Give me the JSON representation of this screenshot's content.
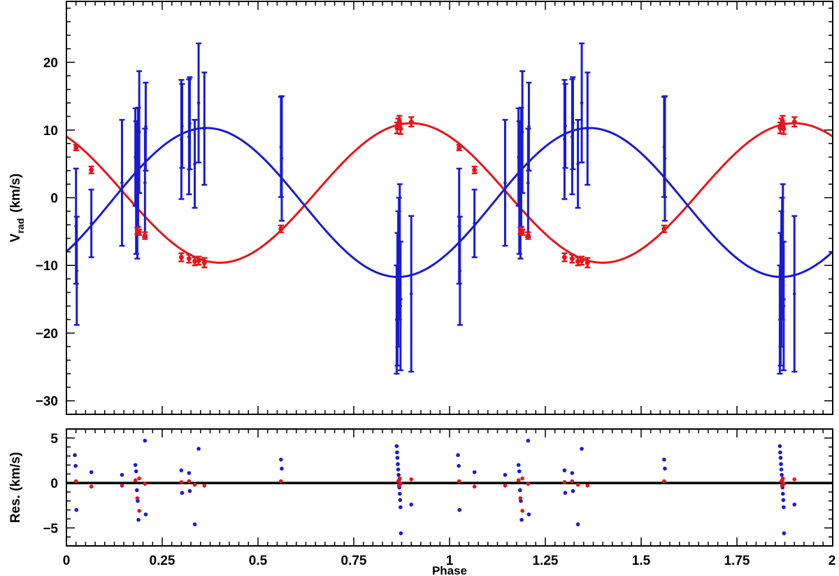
{
  "chart_data": [
    {
      "type": "scatter",
      "panel": "top",
      "xlabel": "",
      "ylabel_main": "V",
      "ylabel_sub": "rad",
      "ylabel_unit": "(km/s)",
      "xlim": [
        0,
        2
      ],
      "ylim": [
        -32,
        29
      ],
      "y_ticks": [
        20,
        10,
        0,
        -10,
        -20,
        -30
      ],
      "y_tick_labels": [
        "20",
        "10",
        "0",
        "−10",
        "−20",
        "−30"
      ],
      "colors": {
        "primary": "#e8141b",
        "secondary": "#1a1ad6",
        "axis": "#000000"
      },
      "models": [
        {
          "color": "#e8141b",
          "gamma": 0.7,
          "K": 10.3,
          "phase_max": 0.9
        },
        {
          "color": "#1a1ad6",
          "gamma": -0.7,
          "K": 11.0,
          "phase_max": 0.365
        }
      ],
      "series": [
        {
          "color": "#e8141b",
          "points": [
            {
              "x": 0.025,
              "y": 7.4,
              "err": 0.4
            },
            {
              "x": 0.065,
              "y": 4.1,
              "err": 0.5
            },
            {
              "x": 0.185,
              "y": -4.9,
              "err": 0.5
            },
            {
              "x": 0.19,
              "y": -5.1,
              "err": 0.4
            },
            {
              "x": 0.205,
              "y": -5.6,
              "err": 0.5
            },
            {
              "x": 0.3,
              "y": -8.8,
              "err": 0.6
            },
            {
              "x": 0.32,
              "y": -9.0,
              "err": 0.6
            },
            {
              "x": 0.335,
              "y": -9.4,
              "err": 0.6
            },
            {
              "x": 0.345,
              "y": -9.3,
              "err": 0.6
            },
            {
              "x": 0.36,
              "y": -9.6,
              "err": 0.7
            },
            {
              "x": 0.56,
              "y": -4.6,
              "err": 0.5
            },
            {
              "x": 0.863,
              "y": 10.3,
              "err": 0.8
            },
            {
              "x": 0.866,
              "y": 10.9,
              "err": 0.8
            },
            {
              "x": 0.869,
              "y": 11.3,
              "err": 0.8
            },
            {
              "x": 0.872,
              "y": 10.2,
              "err": 0.8
            },
            {
              "x": 0.9,
              "y": 11.2,
              "err": 0.7
            },
            {
              "x": 1.025,
              "y": 7.4,
              "err": 0.4
            },
            {
              "x": 1.065,
              "y": 4.1,
              "err": 0.5
            },
            {
              "x": 1.185,
              "y": -4.9,
              "err": 0.5
            },
            {
              "x": 1.19,
              "y": -5.1,
              "err": 0.4
            },
            {
              "x": 1.205,
              "y": -5.6,
              "err": 0.5
            },
            {
              "x": 1.3,
              "y": -8.8,
              "err": 0.6
            },
            {
              "x": 1.32,
              "y": -9.0,
              "err": 0.6
            },
            {
              "x": 1.335,
              "y": -9.4,
              "err": 0.6
            },
            {
              "x": 1.345,
              "y": -9.3,
              "err": 0.6
            },
            {
              "x": 1.36,
              "y": -9.6,
              "err": 0.7
            },
            {
              "x": 1.56,
              "y": -4.6,
              "err": 0.5
            },
            {
              "x": 1.863,
              "y": 10.3,
              "err": 0.8
            },
            {
              "x": 1.866,
              "y": 10.9,
              "err": 0.8
            },
            {
              "x": 1.869,
              "y": 11.3,
              "err": 0.8
            },
            {
              "x": 1.872,
              "y": 10.2,
              "err": 0.8
            },
            {
              "x": 1.9,
              "y": 11.2,
              "err": 0.7
            }
          ]
        },
        {
          "color": "#1a1ad6",
          "points": [
            {
              "x": 0.025,
              "y": -4.2,
              "err": 8.5
            },
            {
              "x": 0.027,
              "y": -10.8,
              "err": 8.0
            },
            {
              "x": 0.065,
              "y": -3.8,
              "err": 5.0
            },
            {
              "x": 0.145,
              "y": 2.2,
              "err": 9.3
            },
            {
              "x": 0.18,
              "y": 6.0,
              "err": 7.2
            },
            {
              "x": 0.182,
              "y": 1.5,
              "err": 9.8
            },
            {
              "x": 0.185,
              "y": -1.2,
              "err": 7.8
            },
            {
              "x": 0.187,
              "y": 4.5,
              "err": 8.8
            },
            {
              "x": 0.19,
              "y": 9.7,
              "err": 9.0
            },
            {
              "x": 0.205,
              "y": 2.2,
              "err": 8.0
            },
            {
              "x": 0.207,
              "y": 10.5,
              "err": 6.5
            },
            {
              "x": 0.3,
              "y": 8.6,
              "err": 8.8
            },
            {
              "x": 0.302,
              "y": 10.6,
              "err": 6.2
            },
            {
              "x": 0.32,
              "y": 9.0,
              "err": 8.5
            },
            {
              "x": 0.322,
              "y": 11.0,
              "err": 6.8
            },
            {
              "x": 0.335,
              "y": 5.0,
              "err": 6.5
            },
            {
              "x": 0.345,
              "y": 14.0,
              "err": 8.8
            },
            {
              "x": 0.36,
              "y": 10.2,
              "err": 8.3
            },
            {
              "x": 0.56,
              "y": 7.5,
              "err": 7.4
            },
            {
              "x": 0.562,
              "y": 5.8,
              "err": 9.2
            },
            {
              "x": 0.862,
              "y": -18.0,
              "err": 8.0
            },
            {
              "x": 0.864,
              "y": -15.0,
              "err": 9.8
            },
            {
              "x": 0.866,
              "y": -12.0,
              "err": 10.0
            },
            {
              "x": 0.868,
              "y": -9.0,
              "err": 9.0
            },
            {
              "x": 0.87,
              "y": -6.5,
              "err": 8.5
            },
            {
              "x": 0.872,
              "y": -16.0,
              "err": 9.5
            },
            {
              "x": 0.9,
              "y": -14.2,
              "err": 11.5
            },
            {
              "x": 1.025,
              "y": -4.2,
              "err": 8.5
            },
            {
              "x": 1.027,
              "y": -10.8,
              "err": 8.0
            },
            {
              "x": 1.065,
              "y": -3.8,
              "err": 5.0
            },
            {
              "x": 1.145,
              "y": 2.2,
              "err": 9.3
            },
            {
              "x": 1.18,
              "y": 6.0,
              "err": 7.2
            },
            {
              "x": 1.182,
              "y": 1.5,
              "err": 9.8
            },
            {
              "x": 1.185,
              "y": -1.2,
              "err": 7.8
            },
            {
              "x": 1.187,
              "y": 4.5,
              "err": 8.8
            },
            {
              "x": 1.19,
              "y": 9.7,
              "err": 9.0
            },
            {
              "x": 1.205,
              "y": 2.2,
              "err": 8.0
            },
            {
              "x": 1.207,
              "y": 10.5,
              "err": 6.5
            },
            {
              "x": 1.3,
              "y": 8.6,
              "err": 8.8
            },
            {
              "x": 1.302,
              "y": 10.6,
              "err": 6.2
            },
            {
              "x": 1.32,
              "y": 9.0,
              "err": 8.5
            },
            {
              "x": 1.322,
              "y": 11.0,
              "err": 6.8
            },
            {
              "x": 1.335,
              "y": 5.0,
              "err": 6.5
            },
            {
              "x": 1.345,
              "y": 14.0,
              "err": 8.8
            },
            {
              "x": 1.36,
              "y": 10.2,
              "err": 8.3
            },
            {
              "x": 1.56,
              "y": 7.5,
              "err": 7.4
            },
            {
              "x": 1.562,
              "y": 5.8,
              "err": 9.2
            },
            {
              "x": 1.862,
              "y": -18.0,
              "err": 8.0
            },
            {
              "x": 1.864,
              "y": -15.0,
              "err": 9.8
            },
            {
              "x": 1.866,
              "y": -12.0,
              "err": 10.0
            },
            {
              "x": 1.868,
              "y": -9.0,
              "err": 9.0
            },
            {
              "x": 1.87,
              "y": -6.5,
              "err": 8.5
            },
            {
              "x": 1.872,
              "y": -16.0,
              "err": 9.5
            },
            {
              "x": 1.9,
              "y": -14.2,
              "err": 11.5
            }
          ]
        }
      ]
    },
    {
      "type": "scatter",
      "panel": "bottom",
      "xlabel": "Phase",
      "ylabel": "Res. (km/s)",
      "xlim": [
        0,
        2
      ],
      "ylim": [
        -7,
        6
      ],
      "x_ticks": [
        0,
        0.25,
        0.5,
        0.75,
        1,
        1.25,
        1.5,
        1.75,
        2
      ],
      "x_tick_labels": [
        "0",
        "0.25",
        "0.5",
        "0.75",
        "1",
        "1.25",
        "1.5",
        "1.75",
        "2"
      ],
      "y_ticks": [
        5,
        0,
        -5
      ],
      "y_tick_labels": [
        "5",
        "0",
        "−5"
      ],
      "zero_line": 0,
      "series": [
        {
          "color": "#e8141b",
          "points": [
            {
              "x": 0.025,
              "y": 0.2
            },
            {
              "x": 0.065,
              "y": -0.4
            },
            {
              "x": 0.145,
              "y": -0.3
            },
            {
              "x": 0.18,
              "y": 0.3
            },
            {
              "x": 0.185,
              "y": -1.7
            },
            {
              "x": 0.19,
              "y": -3.1
            },
            {
              "x": 0.19,
              "y": 0.5
            },
            {
              "x": 0.205,
              "y": -0.1
            },
            {
              "x": 0.3,
              "y": 0.1
            },
            {
              "x": 0.32,
              "y": 0.2
            },
            {
              "x": 0.335,
              "y": -0.2
            },
            {
              "x": 0.36,
              "y": -0.3
            },
            {
              "x": 0.56,
              "y": 0.2
            },
            {
              "x": 0.866,
              "y": 0.2
            },
            {
              "x": 0.868,
              "y": -0.3
            },
            {
              "x": 0.87,
              "y": 0.5
            },
            {
              "x": 0.872,
              "y": -0.1
            },
            {
              "x": 0.9,
              "y": 0.4
            },
            {
              "x": 1.025,
              "y": 0.2
            },
            {
              "x": 1.065,
              "y": -0.4
            },
            {
              "x": 1.145,
              "y": -0.3
            },
            {
              "x": 1.18,
              "y": 0.3
            },
            {
              "x": 1.185,
              "y": -1.7
            },
            {
              "x": 1.19,
              "y": -3.1
            },
            {
              "x": 1.19,
              "y": 0.5
            },
            {
              "x": 1.205,
              "y": -0.1
            },
            {
              "x": 1.3,
              "y": 0.1
            },
            {
              "x": 1.32,
              "y": 0.2
            },
            {
              "x": 1.335,
              "y": -0.2
            },
            {
              "x": 1.36,
              "y": -0.3
            },
            {
              "x": 1.56,
              "y": 0.2
            },
            {
              "x": 1.866,
              "y": 0.2
            },
            {
              "x": 1.868,
              "y": -0.3
            },
            {
              "x": 1.87,
              "y": 0.5
            },
            {
              "x": 1.872,
              "y": -0.1
            },
            {
              "x": 1.9,
              "y": 0.4
            }
          ]
        },
        {
          "color": "#1a1ad6",
          "points": [
            {
              "x": 0.022,
              "y": 3.1
            },
            {
              "x": 0.024,
              "y": 1.9
            },
            {
              "x": 0.026,
              "y": -3.0
            },
            {
              "x": 0.065,
              "y": 1.2
            },
            {
              "x": 0.145,
              "y": 0.9
            },
            {
              "x": 0.18,
              "y": 2.0
            },
            {
              "x": 0.182,
              "y": 1.3
            },
            {
              "x": 0.184,
              "y": -0.8
            },
            {
              "x": 0.186,
              "y": -2.0
            },
            {
              "x": 0.188,
              "y": -4.1
            },
            {
              "x": 0.205,
              "y": 4.7
            },
            {
              "x": 0.207,
              "y": -3.5
            },
            {
              "x": 0.3,
              "y": 1.4
            },
            {
              "x": 0.302,
              "y": -1.1
            },
            {
              "x": 0.32,
              "y": 1.1
            },
            {
              "x": 0.322,
              "y": -0.9
            },
            {
              "x": 0.335,
              "y": -4.6
            },
            {
              "x": 0.345,
              "y": 3.8
            },
            {
              "x": 0.56,
              "y": 2.6
            },
            {
              "x": 0.562,
              "y": 1.6
            },
            {
              "x": 0.862,
              "y": 4.1
            },
            {
              "x": 0.863,
              "y": 3.4
            },
            {
              "x": 0.864,
              "y": 2.8
            },
            {
              "x": 0.865,
              "y": 2.1
            },
            {
              "x": 0.866,
              "y": 1.5
            },
            {
              "x": 0.867,
              "y": 0.9
            },
            {
              "x": 0.868,
              "y": 0.3
            },
            {
              "x": 0.869,
              "y": -0.5
            },
            {
              "x": 0.87,
              "y": -1.2
            },
            {
              "x": 0.871,
              "y": -1.9
            },
            {
              "x": 0.872,
              "y": -2.7
            },
            {
              "x": 0.873,
              "y": -5.6
            },
            {
              "x": 0.9,
              "y": -2.4
            },
            {
              "x": 1.022,
              "y": 3.1
            },
            {
              "x": 1.024,
              "y": 1.9
            },
            {
              "x": 1.026,
              "y": -3.0
            },
            {
              "x": 1.065,
              "y": 1.2
            },
            {
              "x": 1.145,
              "y": 0.9
            },
            {
              "x": 1.18,
              "y": 2.0
            },
            {
              "x": 1.182,
              "y": 1.3
            },
            {
              "x": 1.184,
              "y": -0.8
            },
            {
              "x": 1.186,
              "y": -2.0
            },
            {
              "x": 1.188,
              "y": -4.1
            },
            {
              "x": 1.205,
              "y": 4.7
            },
            {
              "x": 1.207,
              "y": -3.5
            },
            {
              "x": 1.3,
              "y": 1.4
            },
            {
              "x": 1.302,
              "y": -1.1
            },
            {
              "x": 1.32,
              "y": 1.1
            },
            {
              "x": 1.322,
              "y": -0.9
            },
            {
              "x": 1.335,
              "y": -4.6
            },
            {
              "x": 1.345,
              "y": 3.8
            },
            {
              "x": 1.56,
              "y": 2.6
            },
            {
              "x": 1.562,
              "y": 1.6
            },
            {
              "x": 1.862,
              "y": 4.1
            },
            {
              "x": 1.863,
              "y": 3.4
            },
            {
              "x": 1.864,
              "y": 2.8
            },
            {
              "x": 1.865,
              "y": 2.1
            },
            {
              "x": 1.866,
              "y": 1.5
            },
            {
              "x": 1.867,
              "y": 0.9
            },
            {
              "x": 1.868,
              "y": 0.3
            },
            {
              "x": 1.869,
              "y": -0.5
            },
            {
              "x": 1.87,
              "y": -1.2
            },
            {
              "x": 1.871,
              "y": -1.9
            },
            {
              "x": 1.872,
              "y": -2.7
            },
            {
              "x": 1.873,
              "y": -5.6
            },
            {
              "x": 1.9,
              "y": -2.4
            }
          ]
        }
      ]
    }
  ]
}
